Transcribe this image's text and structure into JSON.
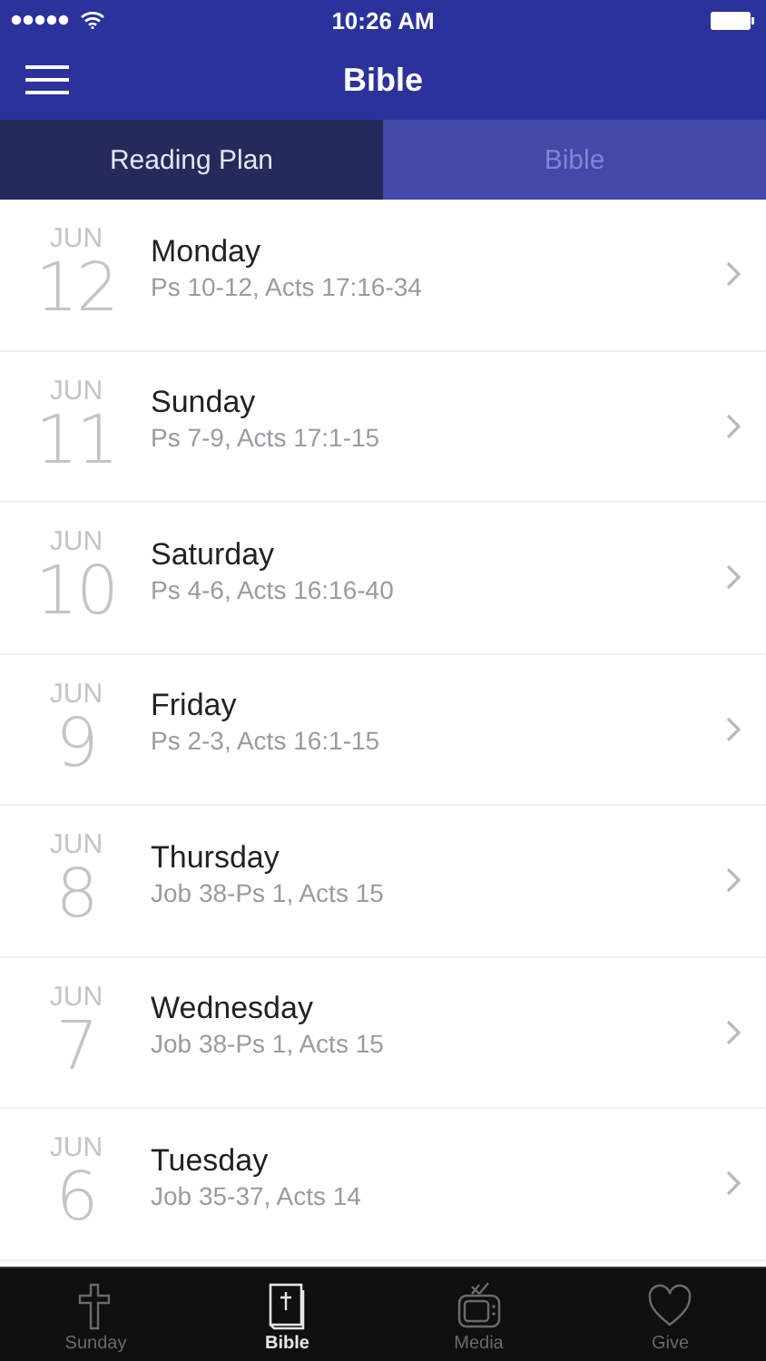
{
  "status_bar": {
    "time": "10:26 AM"
  },
  "nav_bar": {
    "title": "Bible"
  },
  "tabs": [
    {
      "label": "Reading Plan",
      "selected": true
    },
    {
      "label": "Bible",
      "selected": false
    }
  ],
  "readings": [
    {
      "month": "JUN",
      "day": "12",
      "weekday": "Monday",
      "passages": "Ps 10-12, Acts 17:16-34"
    },
    {
      "month": "JUN",
      "day": "11",
      "weekday": "Sunday",
      "passages": "Ps 7-9, Acts 17:1-15"
    },
    {
      "month": "JUN",
      "day": "10",
      "weekday": "Saturday",
      "passages": "Ps 4-6, Acts 16:16-40"
    },
    {
      "month": "JUN",
      "day": "9",
      "weekday": "Friday",
      "passages": "Ps 2-3, Acts 16:1-15"
    },
    {
      "month": "JUN",
      "day": "8",
      "weekday": "Thursday",
      "passages": "Job 38-Ps 1, Acts 15"
    },
    {
      "month": "JUN",
      "day": "7",
      "weekday": "Wednesday",
      "passages": "Job 38-Ps 1, Acts 15"
    },
    {
      "month": "JUN",
      "day": "6",
      "weekday": "Tuesday",
      "passages": "Job 35-37, Acts 14"
    }
  ],
  "tab_bar": [
    {
      "label": "Sunday",
      "selected": false
    },
    {
      "label": "Bible",
      "selected": true
    },
    {
      "label": "Media",
      "selected": false
    },
    {
      "label": "Give",
      "selected": false
    }
  ]
}
